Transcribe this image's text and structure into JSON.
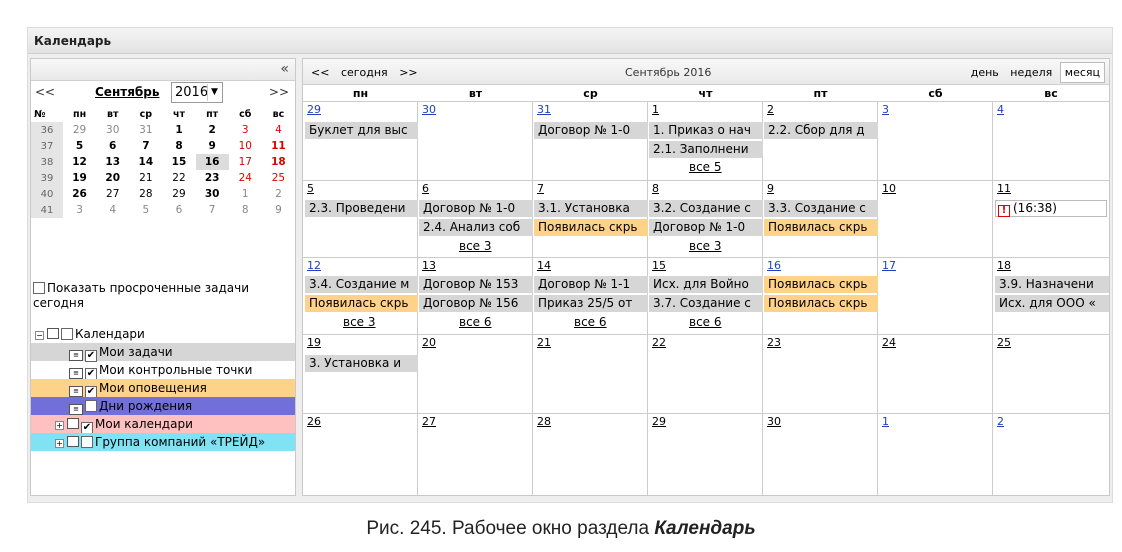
{
  "window_title": "Календарь",
  "collapse_glyph": "«",
  "mini": {
    "prev": "<<",
    "next": ">>",
    "month": "Сентябрь",
    "year": "2016",
    "week_header": "№",
    "day_headers": [
      "пн",
      "вт",
      "ср",
      "чт",
      "пт",
      "сб",
      "вс"
    ],
    "rows": [
      [
        "36",
        "29",
        "30",
        "31",
        "1",
        "2",
        "3",
        "4"
      ],
      [
        "37",
        "5",
        "6",
        "7",
        "8",
        "9",
        "10",
        "11"
      ],
      [
        "38",
        "12",
        "13",
        "14",
        "15",
        "16",
        "17",
        "18"
      ],
      [
        "39",
        "19",
        "20",
        "21",
        "22",
        "23",
        "24",
        "25"
      ],
      [
        "40",
        "26",
        "27",
        "28",
        "29",
        "30",
        "1",
        "2"
      ],
      [
        "41",
        "3",
        "4",
        "5",
        "6",
        "7",
        "8",
        "9"
      ]
    ]
  },
  "show_overdue_label": "Показать просроченные задачи сегодня",
  "tree": {
    "root": "Календари",
    "items": [
      {
        "label": "Мои задачи",
        "checked": true,
        "color": "#d6d6d6"
      },
      {
        "label": "Мои контрольные точки",
        "checked": true,
        "color": "#ffffff"
      },
      {
        "label": "Мои оповещения",
        "checked": true,
        "color": "#ffd28a"
      },
      {
        "label": "Дни рождения",
        "checked": false,
        "color": "#7070d8"
      },
      {
        "label": "Мои календари",
        "checked": true,
        "color": "#ffc0c0"
      },
      {
        "label": "Группа компаний «ТРЕЙД»",
        "checked": false,
        "color": "#7fe3f3"
      }
    ]
  },
  "toolbar": {
    "prev": "<<",
    "today": "сегодня",
    "next": ">>",
    "period": "Сентябрь 2016",
    "view_day": "день",
    "view_week": "неделя",
    "view_month": "месяц"
  },
  "weekdays": [
    "пн",
    "вт",
    "ср",
    "чт",
    "пт",
    "сб",
    "вс"
  ],
  "weeks": [
    [
      "29",
      "30",
      "31",
      "1",
      "2",
      "3",
      "4"
    ],
    [
      "5",
      "6",
      "7",
      "8",
      "9",
      "10",
      "11"
    ],
    [
      "12",
      "13",
      "14",
      "15",
      "16",
      "17",
      "18"
    ],
    [
      "19",
      "20",
      "21",
      "22",
      "23",
      "24",
      "25"
    ],
    [
      "26",
      "27",
      "28",
      "29",
      "30",
      "1",
      "2"
    ]
  ],
  "events": {
    "w0_pn": "Буклет для выс",
    "w0_sr": "Договор № 1-0",
    "w0_cht1": "1. Приказ о нач",
    "w0_cht2": "2.1. Заполнени",
    "w0_pt": "2.2. Сбор для д",
    "w0_more": "все 5",
    "w1_pn": "2.3. Проведени",
    "w1_vt1": "Договор № 1-0",
    "w1_vt2": "2.4. Анализ соб",
    "w1_sr1": "3.1. Установка",
    "w1_sr2": "Появилась скрь",
    "w1_cht1": "3.2. Создание с",
    "w1_cht2": "Договор № 1-0",
    "w1_pt1": "3.3. Создание с",
    "w1_pt2": "Появилась скрь",
    "w1_vs_alert": "(16:38)",
    "w1_more_vt": "все 3",
    "w1_more_cht": "все 3",
    "w2_pn1": "3.4. Создание м",
    "w2_pn2": "Появилась скрь",
    "w2_vt1": "Договор № 153",
    "w2_vt2": "Договор № 156",
    "w2_sr1": "Договор № 1-1",
    "w2_sr2": "Приказ 25/5 от",
    "w2_cht1": "Исх. для Войно",
    "w2_cht2": "3.7. Создание с",
    "w2_pt1": "Появилась скрь",
    "w2_pt2": "Появилась скрь",
    "w2_vs1": "3.9. Назначени",
    "w2_vs2": "Исх. для ООО «",
    "w2_more_pn": "все 3",
    "w2_more_vt": "все 6",
    "w2_more_sr": "все 6",
    "w2_more_cht": "все 6",
    "w3_pn": "3. Установка и"
  },
  "caption_prefix": "Рис. 245. Рабочее окно раздела ",
  "caption_emph": "Календарь"
}
